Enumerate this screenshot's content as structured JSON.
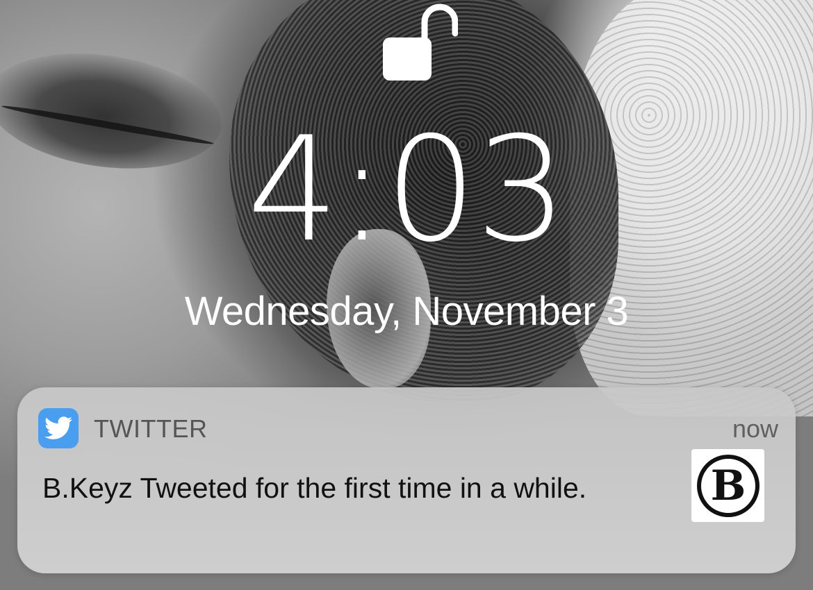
{
  "lockscreen": {
    "lock_state": "unlocked",
    "time": "4:03",
    "date": "Wednesday, November 3"
  },
  "notification": {
    "app_name": "TWITTER",
    "app_icon": "twitter-bird-icon",
    "app_icon_color": "#4A9EF0",
    "timestamp": "now",
    "message": "B.Keyz Tweeted for the first time in a while.",
    "thumbnail": {
      "letter": "B",
      "style": "black circle logo on white"
    }
  }
}
